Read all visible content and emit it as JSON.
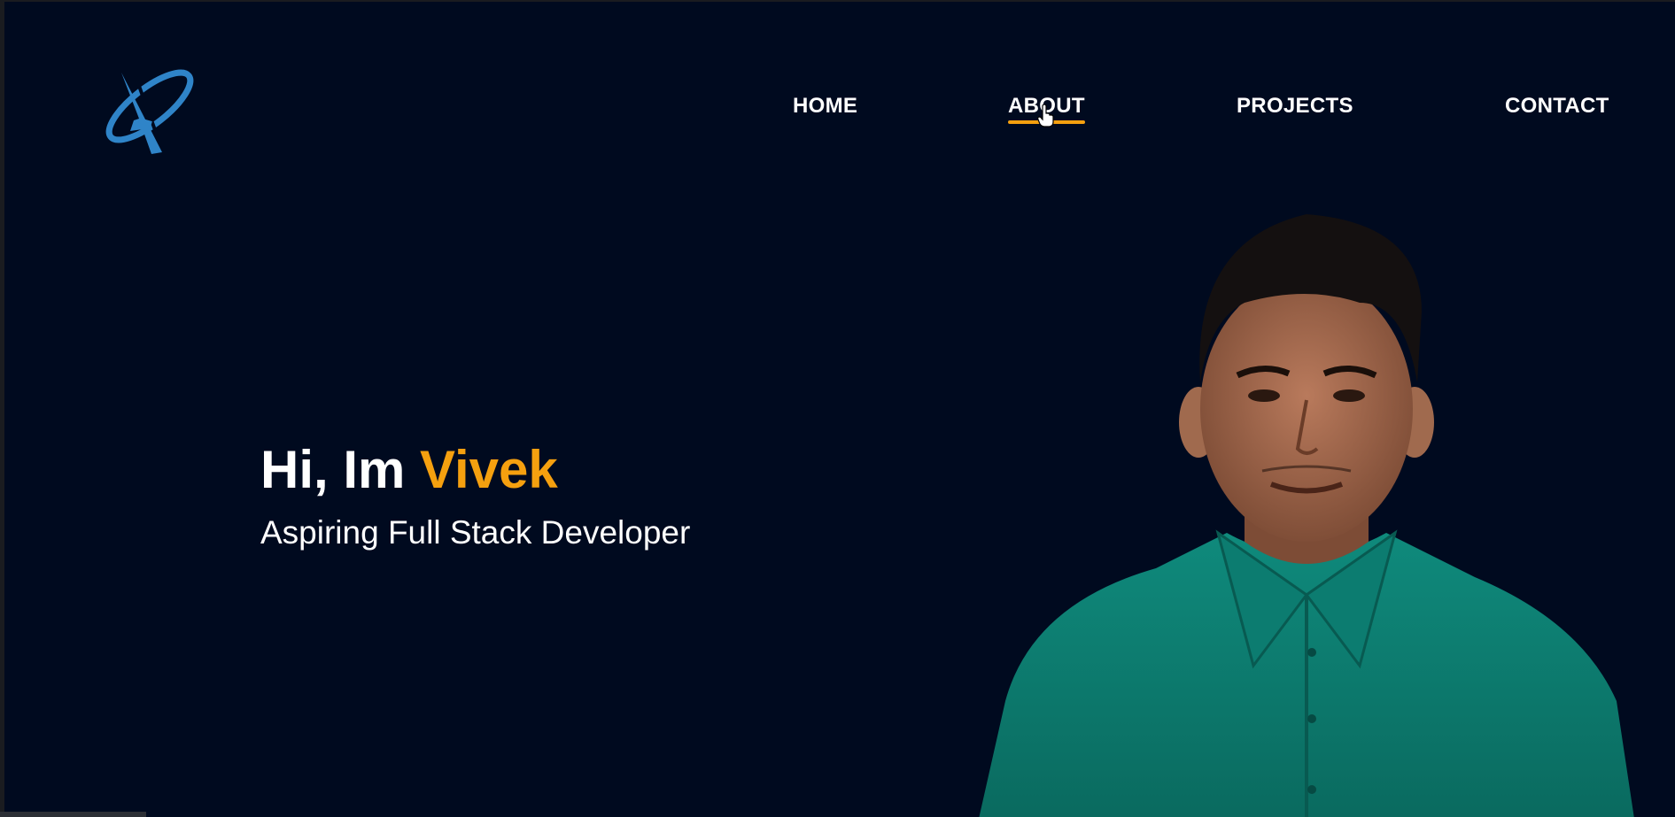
{
  "nav": {
    "items": [
      {
        "label": "HOME"
      },
      {
        "label": "ABOUT",
        "active": true
      },
      {
        "label": "PROJECTS"
      },
      {
        "label": "CONTACT"
      }
    ]
  },
  "hero": {
    "greeting": "Hi, Im",
    "name": "Vivek",
    "subtitle": "Aspiring Full Stack Developer"
  },
  "colors": {
    "background": "#000a1f",
    "accent": "#f5a00f",
    "logo": "#2f84c8",
    "shirt": "#0c7a6e"
  },
  "icons": {
    "logo": "orbit-a-logo",
    "cursor": "hand-pointer-cursor"
  }
}
